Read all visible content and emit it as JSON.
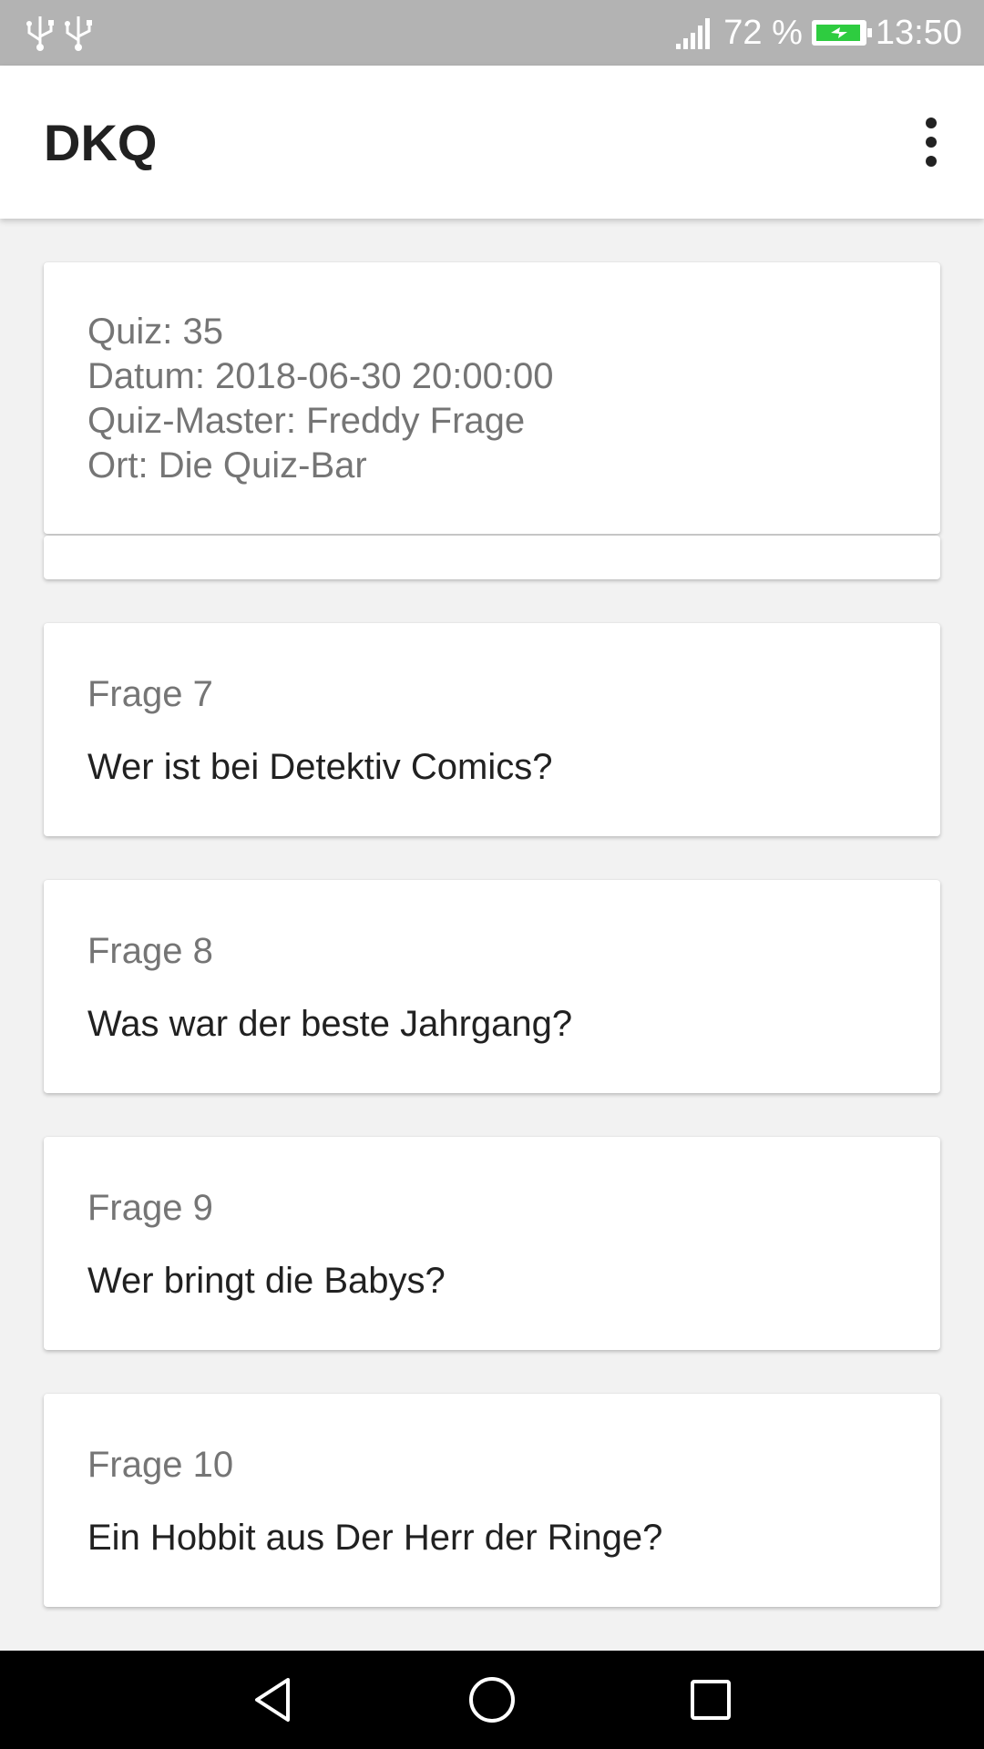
{
  "status_bar": {
    "icons": [
      "usb-icon",
      "usb-icon",
      "signal-icon",
      "battery-charging-icon"
    ],
    "battery": "72 %",
    "time": "13:50"
  },
  "app_bar": {
    "title": "DKQ",
    "menu_icon": "more-vert-icon"
  },
  "quiz_info": {
    "quiz": "Quiz: 35",
    "datum": "Datum: 2018-06-30 20:00:00",
    "quiz_master": "Quiz-Master: Freddy Frage",
    "ort": "Ort: Die Quiz-Bar"
  },
  "questions": [
    {
      "label": "Frage 7",
      "text": "Wer ist bei Detektiv Comics?"
    },
    {
      "label": "Frage 8",
      "text": "Was war der beste Jahrgang?"
    },
    {
      "label": "Frage 9",
      "text": "Wer bringt die Babys?"
    },
    {
      "label": "Frage 10",
      "text": "Ein Hobbit aus Der Herr der Ringe?"
    }
  ],
  "nav_bar": {
    "icons": [
      "back-icon",
      "home-icon",
      "recents-icon"
    ]
  },
  "colors": {
    "status_bar": "#b3b3b3",
    "background": "#f2f2f2",
    "card": "#ffffff",
    "secondary_text": "#757575",
    "primary_text": "#212121",
    "battery_fill": "#2ecc40"
  }
}
